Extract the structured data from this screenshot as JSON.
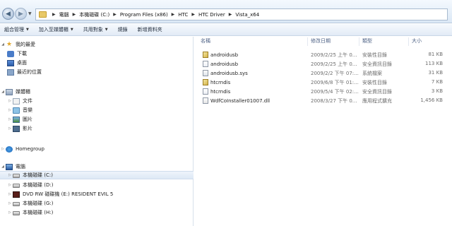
{
  "addressbar": {
    "crumbs": [
      "電腦",
      "本機磁碟 (C:)",
      "Program Files (x86)",
      "HTC",
      "HTC Driver",
      "Vista_x64"
    ]
  },
  "toolbar": {
    "organize": "組合管理",
    "add_to_library": "加入至媒體櫃",
    "share_with": "共用對象",
    "burn": "燒錄",
    "new_folder": "新增資料夾"
  },
  "sidebar": {
    "favorites": {
      "label": "我的最愛",
      "items": [
        "下載",
        "桌面",
        "最近的位置"
      ]
    },
    "libraries": {
      "label": "媒體櫃",
      "items": [
        "文件",
        "音樂",
        "圖片",
        "影片"
      ]
    },
    "homegroup": "Homegroup",
    "computer": {
      "label": "電腦",
      "drives": [
        "本機磁碟 (C:)",
        "本機磁碟 (D:)",
        "DVD RW 磁碟機 (E:) RESIDENT EVIL 5",
        "本機磁碟 (G:)",
        "本機磁碟 (H:)"
      ]
    }
  },
  "columns": {
    "name": "名稱",
    "date": "修改日期",
    "type": "類型",
    "size": "大小"
  },
  "files": [
    {
      "name": "androidusb",
      "date": "2009/2/25 上午 0...",
      "type": "安裝性目錄",
      "size": "81 KB",
      "icon": "setup-info-icon"
    },
    {
      "name": "androidusb",
      "date": "2009/2/25 上午 0...",
      "type": "安全資訊目錄",
      "size": "113 KB",
      "icon": "catalog-icon"
    },
    {
      "name": "androidusb.sys",
      "date": "2009/2/2 下午 07:...",
      "type": "系統檔案",
      "size": "31 KB",
      "icon": "sys-file-icon"
    },
    {
      "name": "htcrndis",
      "date": "2009/6/8 下午 01:...",
      "type": "安裝性目錄",
      "size": "7 KB",
      "icon": "setup-info-icon"
    },
    {
      "name": "htcrndis",
      "date": "2009/5/4 下午 02:...",
      "type": "安全資訊目錄",
      "size": "3 KB",
      "icon": "catalog-icon"
    },
    {
      "name": "WdfCoInstaller01007.dll",
      "date": "2008/3/27 下午 0...",
      "type": "應用程式擴充",
      "size": "1,456 KB",
      "icon": "dll-file-icon"
    }
  ],
  "colors": {
    "header_text": "#4d6185",
    "selected_row": "#dde8f5"
  }
}
